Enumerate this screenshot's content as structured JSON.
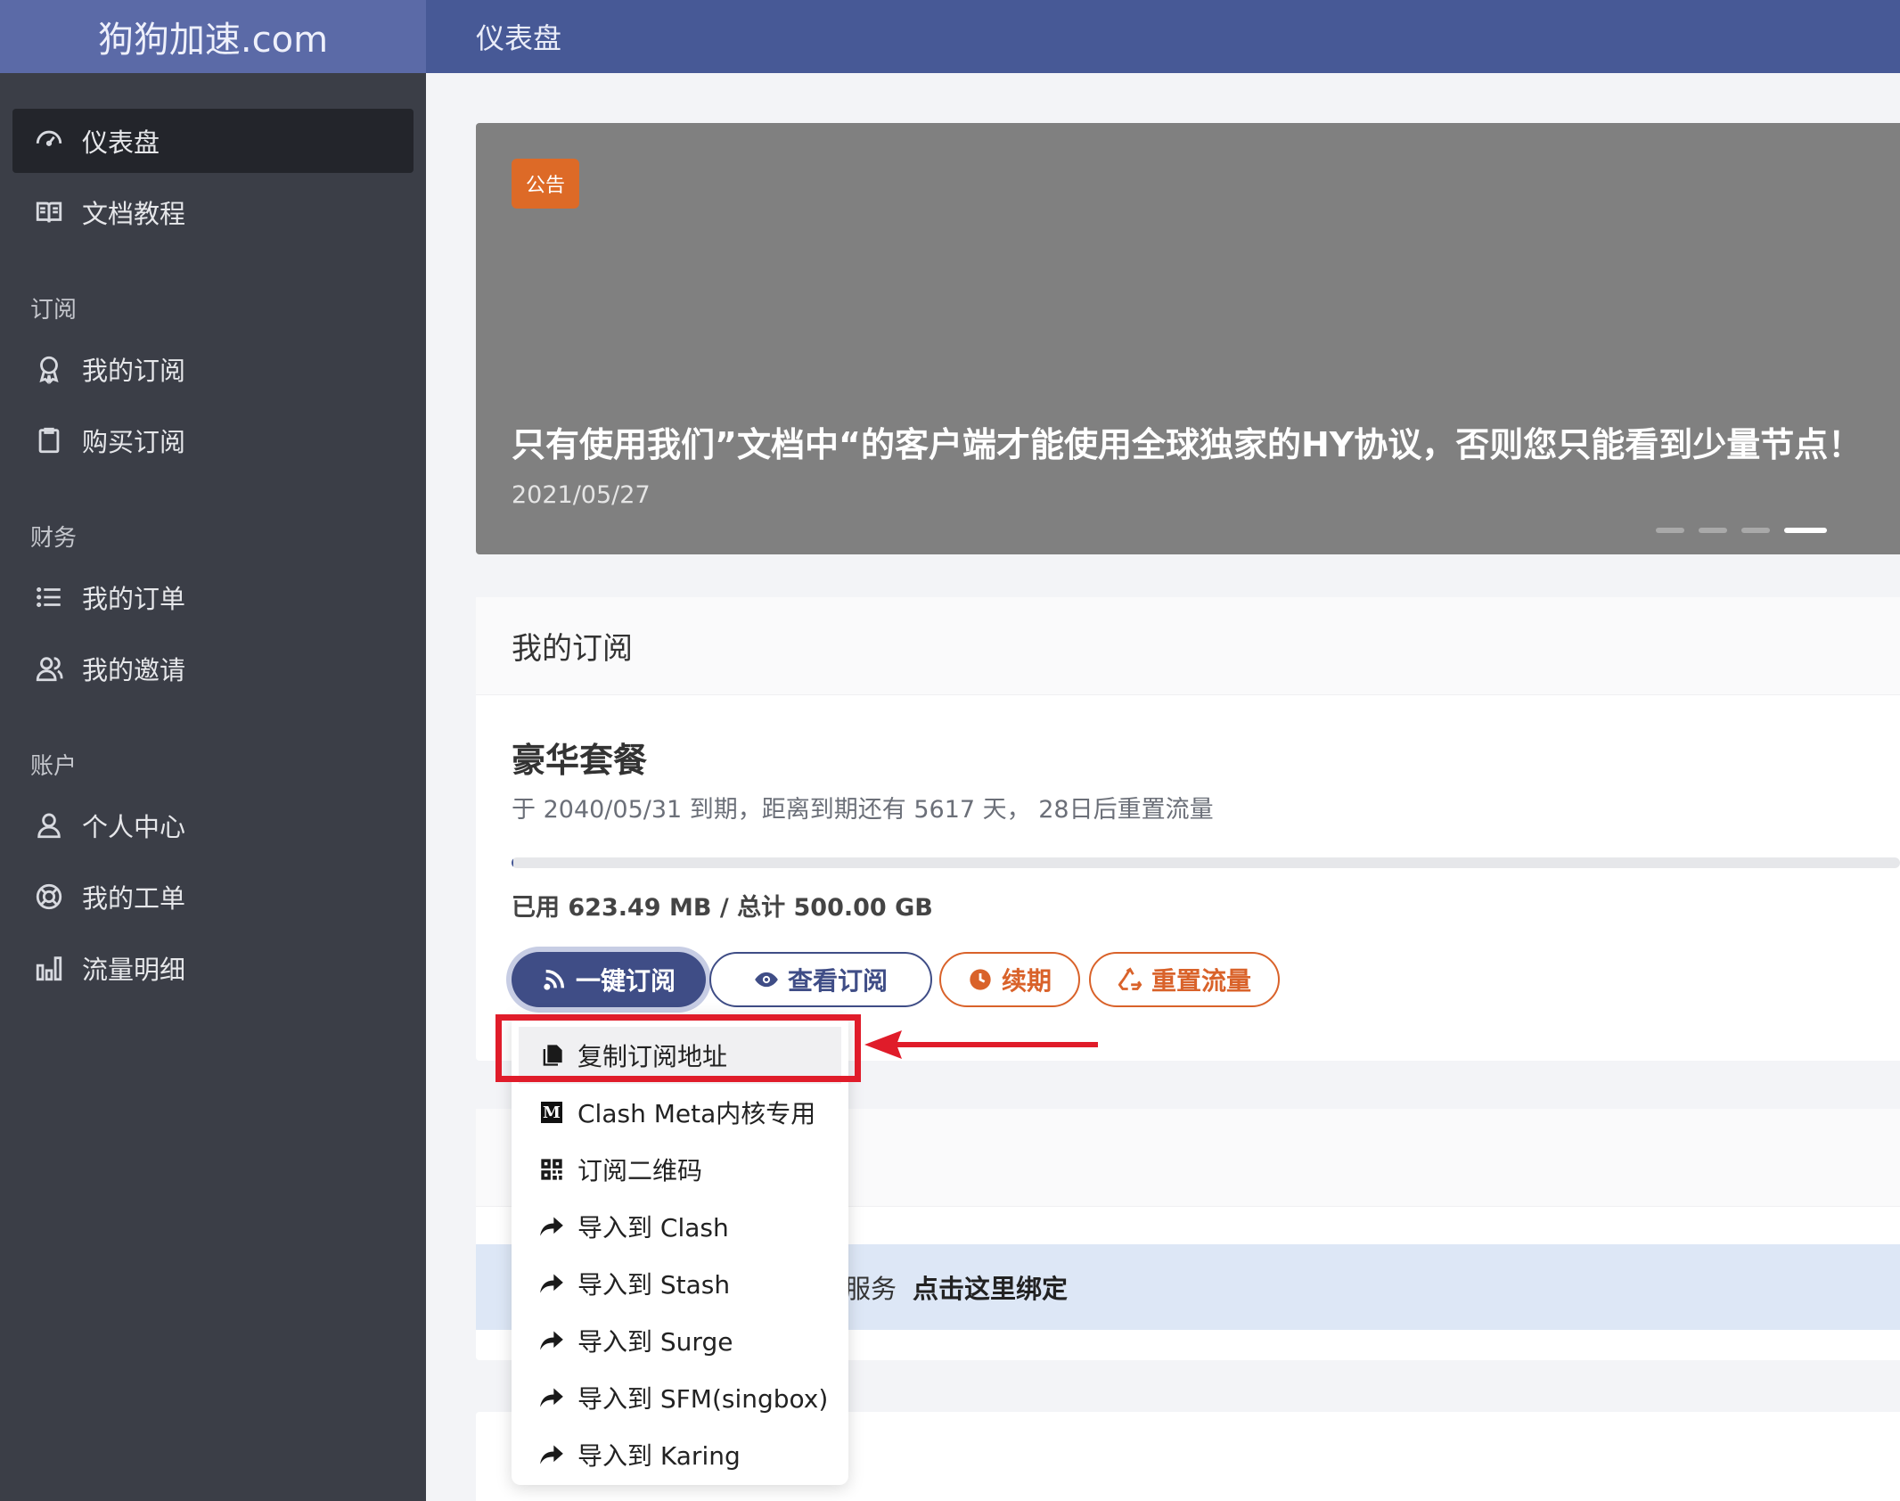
{
  "brand": "狗狗加速.com",
  "header": {
    "title": "仪表盘"
  },
  "sidebar": {
    "items_top": [
      {
        "label": "仪表盘",
        "icon": "dashboard-icon",
        "active": true
      },
      {
        "label": "文档教程",
        "icon": "book-icon"
      }
    ],
    "sections": [
      {
        "title": "订阅",
        "items": [
          {
            "label": "我的订阅",
            "icon": "award-icon"
          },
          {
            "label": "购买订阅",
            "icon": "clipboard-icon"
          }
        ]
      },
      {
        "title": "财务",
        "items": [
          {
            "label": "我的订单",
            "icon": "list-icon"
          },
          {
            "label": "我的邀请",
            "icon": "users-icon"
          }
        ]
      },
      {
        "title": "账户",
        "items": [
          {
            "label": "个人中心",
            "icon": "user-icon"
          },
          {
            "label": "我的工单",
            "icon": "lifebuoy-icon"
          },
          {
            "label": "流量明细",
            "icon": "bar-chart-icon"
          }
        ]
      }
    ]
  },
  "banner": {
    "badge": "公告",
    "title": "只有使用我们”文档中“的客户端才能使用全球独家的HY协议，否则您只能看到少量节点！",
    "date": "2021/05/27",
    "slide_count": 4,
    "active_slide": 4
  },
  "subscription": {
    "card_title": "我的订阅",
    "plan_name": "豪华套餐",
    "info": "于 2040/05/31 到期，距离到期还有 5617 天， 28日后重置流量",
    "usage": "已用 623.49 MB / 总计 500.00 GB",
    "usage_fraction": 0.0012,
    "buttons": {
      "subscribe": "一键订阅",
      "view": "查看订阅",
      "renew": "续期",
      "reset": "重置流量"
    }
  },
  "alert": {
    "text": "服务",
    "link": "点击这里绑定"
  },
  "dropdown": {
    "items": [
      {
        "label": "复制订阅地址",
        "icon": "copy-icon"
      },
      {
        "label": "Clash Meta内核专用",
        "icon": "m-icon",
        "icon_letter": "M"
      },
      {
        "label": "订阅二维码",
        "icon": "qrcode-icon"
      },
      {
        "label": "导入到 Clash",
        "icon": "share-icon"
      },
      {
        "label": "导入到 Stash",
        "icon": "share-icon"
      },
      {
        "label": "导入到 Surge",
        "icon": "share-icon"
      },
      {
        "label": "导入到 SFM(singbox)",
        "icon": "share-icon"
      },
      {
        "label": "导入到 Karing",
        "icon": "share-icon"
      }
    ]
  },
  "colors": {
    "accent": "#475996",
    "brand_bar": "#5b6aa7",
    "sidebar": "#3b3e47",
    "orange": "#d9622a",
    "annotation": "#e01c2a"
  }
}
